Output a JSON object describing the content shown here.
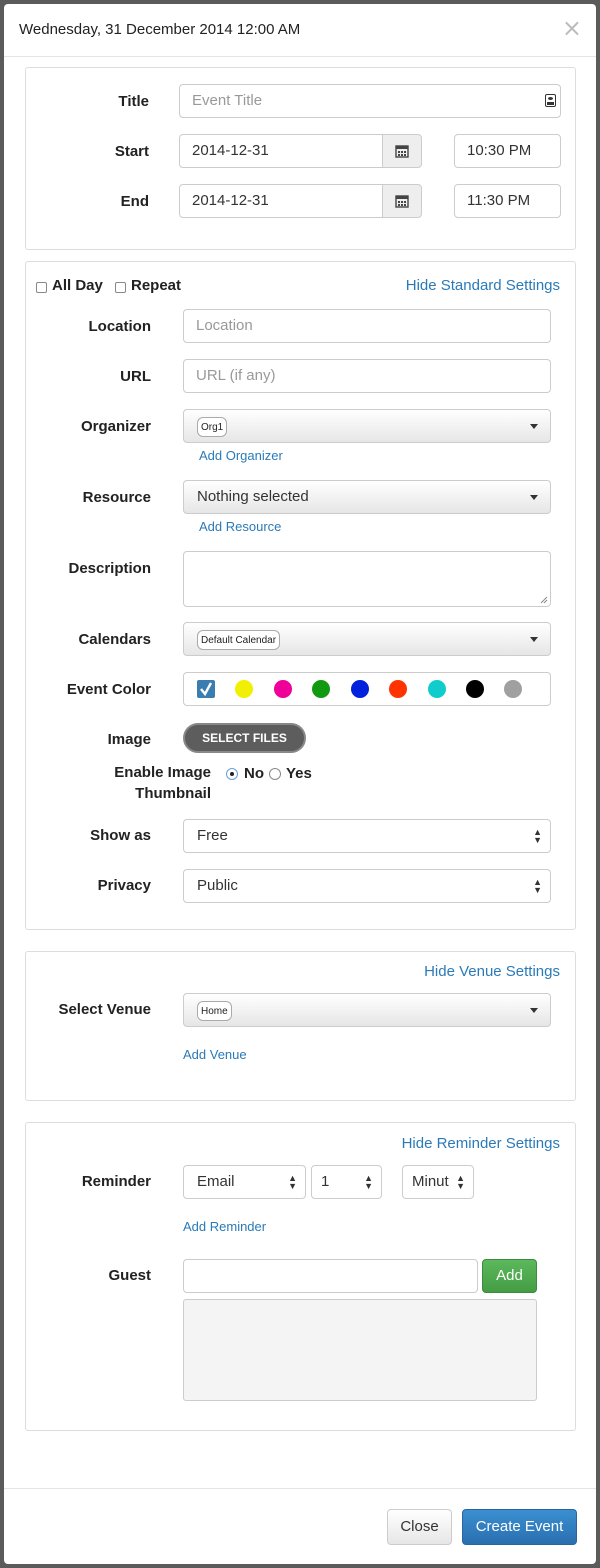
{
  "header": {
    "title": "Wednesday, 31 December 2014 12:00 AM"
  },
  "basic": {
    "title_label": "Title",
    "title_placeholder": "Event Title",
    "start_label": "Start",
    "start_date": "2014-12-31",
    "start_time": "10:30 PM",
    "end_label": "End",
    "end_date": "2014-12-31",
    "end_time": "11:30 PM"
  },
  "standard": {
    "all_day": "All Day",
    "repeat": "Repeat",
    "toggle_link": "Hide Standard Settings",
    "location_label": "Location",
    "location_placeholder": "Location",
    "url_label": "URL",
    "url_placeholder": "URL (if any)",
    "organizer_label": "Organizer",
    "organizer_chip": "Org1",
    "add_organizer": "Add Organizer",
    "resource_label": "Resource",
    "resource_value": "Nothing selected",
    "add_resource": "Add Resource",
    "description_label": "Description",
    "calendars_label": "Calendars",
    "calendar_chip": "Default Calendar",
    "event_color_label": "Event Color",
    "colors": [
      "#3a7db0",
      "#f0f000",
      "#ee0099",
      "#119911",
      "#0022dd",
      "#ff3300",
      "#11cccc",
      "#000000",
      "#a0a0a0"
    ],
    "image_label": "Image",
    "select_files": "SELECT FILES",
    "thumb_label_1": "Enable Image",
    "thumb_label_2": "Thumbnail",
    "thumb_no": "No",
    "thumb_yes": "Yes",
    "show_as_label": "Show as",
    "show_as_value": "Free",
    "privacy_label": "Privacy",
    "privacy_value": "Public"
  },
  "venue": {
    "toggle_link": "Hide Venue Settings",
    "select_label": "Select Venue",
    "venue_chip": "Home",
    "add_venue": "Add Venue"
  },
  "reminder": {
    "toggle_link": "Hide Reminder Settings",
    "label": "Reminder",
    "method": "Email",
    "amount": "1",
    "unit": "Minut",
    "add_reminder": "Add Reminder",
    "guest_label": "Guest",
    "add_button": "Add"
  },
  "footer": {
    "close": "Close",
    "create": "Create Event"
  }
}
